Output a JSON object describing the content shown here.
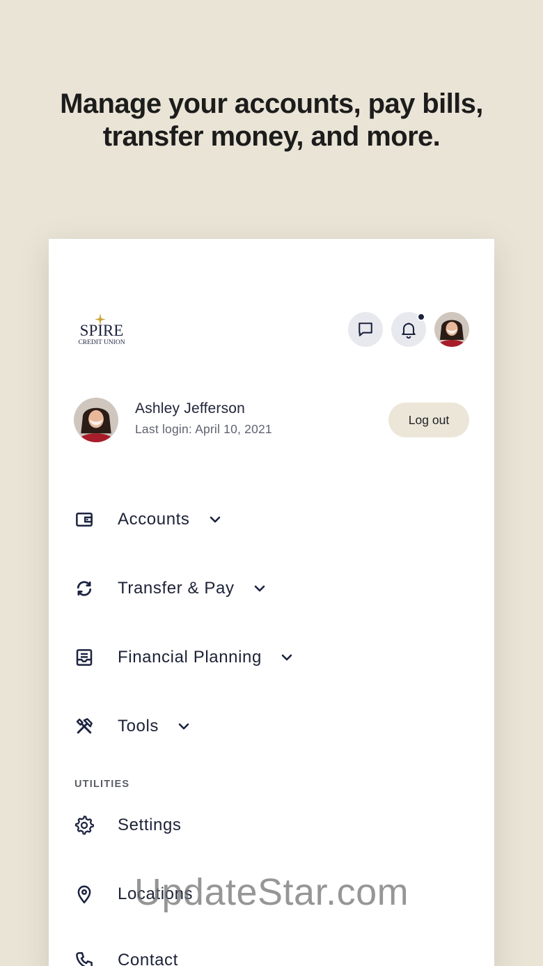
{
  "headline": {
    "line1": "Manage your accounts, pay bills,",
    "line2": "transfer money, and more."
  },
  "brand": {
    "logo_text": "SPIRE",
    "logo_subtext": "CREDIT UNION"
  },
  "header_icons": {
    "messages": "chat-icon",
    "notifications": "bell-icon",
    "notification_indicator": true
  },
  "profile": {
    "name": "Ashley Jefferson",
    "last_login": "Last login: April 10, 2021",
    "logout_label": "Log out"
  },
  "nav": {
    "items": [
      {
        "label": "Accounts",
        "icon": "wallet-icon"
      },
      {
        "label": "Transfer & Pay",
        "icon": "transfer-icon"
      },
      {
        "label": "Financial Planning",
        "icon": "planning-icon"
      },
      {
        "label": "Tools",
        "icon": "tools-icon"
      }
    ],
    "utilities_label": "UTILITIES",
    "utilities": [
      {
        "label": "Settings",
        "icon": "gear-icon"
      },
      {
        "label": "Locations",
        "icon": "location-pin-icon"
      },
      {
        "label": "Contact",
        "icon": "phone-icon"
      }
    ]
  },
  "watermark": "UpdateStar.com",
  "colors": {
    "background": "#e9e4d6",
    "card": "#ffffff",
    "navy": "#1c2340",
    "logout_bg": "#ebe6d7",
    "icon_bg": "#e8e9ee"
  }
}
